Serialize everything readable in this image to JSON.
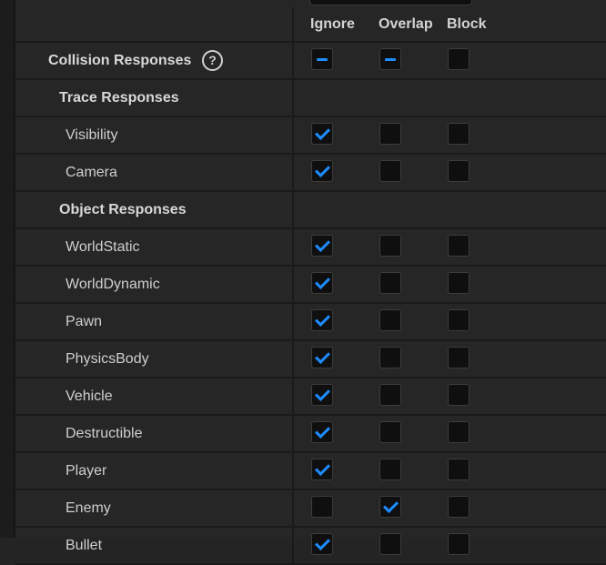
{
  "columns": [
    "Ignore",
    "Overlap",
    "Block"
  ],
  "collision_responses": {
    "label": "Collision Responses",
    "help_icon": "?",
    "states": [
      "mixed",
      "mixed",
      "unchecked"
    ]
  },
  "trace_responses": {
    "label": "Trace Responses",
    "items": [
      {
        "label": "Visibility",
        "states": [
          "checked",
          "unchecked",
          "unchecked"
        ]
      },
      {
        "label": "Camera",
        "states": [
          "checked",
          "unchecked",
          "unchecked"
        ]
      }
    ]
  },
  "object_responses": {
    "label": "Object Responses",
    "items": [
      {
        "label": "WorldStatic",
        "states": [
          "checked",
          "unchecked",
          "unchecked"
        ]
      },
      {
        "label": "WorldDynamic",
        "states": [
          "checked",
          "unchecked",
          "unchecked"
        ]
      },
      {
        "label": "Pawn",
        "states": [
          "checked",
          "unchecked",
          "unchecked"
        ]
      },
      {
        "label": "PhysicsBody",
        "states": [
          "checked",
          "unchecked",
          "unchecked"
        ]
      },
      {
        "label": "Vehicle",
        "states": [
          "checked",
          "unchecked",
          "unchecked"
        ]
      },
      {
        "label": "Destructible",
        "states": [
          "checked",
          "unchecked",
          "unchecked"
        ]
      },
      {
        "label": "Player",
        "states": [
          "checked",
          "unchecked",
          "unchecked"
        ]
      },
      {
        "label": "Enemy",
        "states": [
          "unchecked",
          "checked",
          "unchecked"
        ]
      },
      {
        "label": "Bullet",
        "states": [
          "checked",
          "unchecked",
          "unchecked"
        ]
      }
    ]
  },
  "colors": {
    "accent": "#1d8cff",
    "background": "#262626"
  }
}
